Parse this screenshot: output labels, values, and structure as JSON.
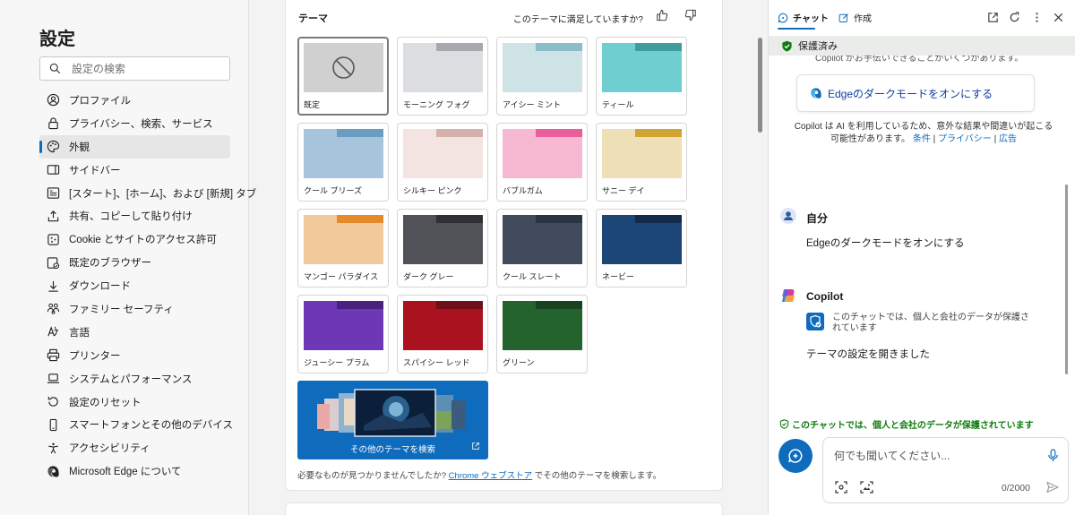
{
  "settings": {
    "title": "設定",
    "search_placeholder": "設定の検索",
    "nav": [
      {
        "label": "プロファイル",
        "icon": "profile-icon"
      },
      {
        "label": "プライバシー、検索、サービス",
        "icon": "lock-icon"
      },
      {
        "label": "外観",
        "icon": "palette-icon",
        "active": true
      },
      {
        "label": "サイドバー",
        "icon": "sidebar-icon"
      },
      {
        "label": "[スタート]、[ホーム]、および [新規] タブ",
        "icon": "home-tab-icon"
      },
      {
        "label": "共有、コピーして貼り付け",
        "icon": "share-icon"
      },
      {
        "label": "Cookie とサイトのアクセス許可",
        "icon": "cookie-icon"
      },
      {
        "label": "既定のブラウザー",
        "icon": "browser-icon"
      },
      {
        "label": "ダウンロード",
        "icon": "download-icon"
      },
      {
        "label": "ファミリー セーフティ",
        "icon": "family-icon"
      },
      {
        "label": "言語",
        "icon": "language-icon"
      },
      {
        "label": "プリンター",
        "icon": "printer-icon"
      },
      {
        "label": "システムとパフォーマンス",
        "icon": "laptop-icon"
      },
      {
        "label": "設定のリセット",
        "icon": "reset-icon"
      },
      {
        "label": "スマートフォンとその他のデバイス",
        "icon": "phone-icon"
      },
      {
        "label": "アクセシビリティ",
        "icon": "accessibility-icon"
      },
      {
        "label": "Microsoft Edge について",
        "icon": "edge-icon"
      }
    ]
  },
  "themes": {
    "title": "テーマ",
    "feedback_question": "このテーマに満足していますか?",
    "items": [
      {
        "label": "既定",
        "selected": true,
        "default": true,
        "tab": "#d0d0d0",
        "body": "#d0d0d0"
      },
      {
        "label": "モーニング フォグ",
        "tab": "#a5a9ae",
        "body": "#dcdde1"
      },
      {
        "label": "アイシー ミント",
        "tab": "#8bbdc6",
        "body": "#cde3e6"
      },
      {
        "label": "ティール",
        "tab": "#3f9d9d",
        "body": "#6fcfd0"
      },
      {
        "label": "クール ブリーズ",
        "tab": "#6b9cc2",
        "body": "#a6c4db"
      },
      {
        "label": "シルキー ピンク",
        "tab": "#d6b1ab",
        "body": "#f3e3e1"
      },
      {
        "label": "バブルガム",
        "tab": "#e95f9b",
        "body": "#f7b8d2"
      },
      {
        "label": "サニー デイ",
        "tab": "#d2a431",
        "body": "#eedfb7"
      },
      {
        "label": "マンゴー パラダイス",
        "tab": "#e48a2a",
        "body": "#f2c99b"
      },
      {
        "label": "ダーク グレー",
        "tab": "#2f3033",
        "body": "#515257"
      },
      {
        "label": "クール スレート",
        "tab": "#2b3444",
        "body": "#414b5c"
      },
      {
        "label": "ネービー",
        "tab": "#132a4a",
        "body": "#1c4676"
      },
      {
        "label": "ジューシー プラム",
        "tab": "#4b2180",
        "body": "#6e37b5"
      },
      {
        "label": "スパイシー レッド",
        "tab": "#6e1017",
        "body": "#a9121e"
      },
      {
        "label": "グリーン",
        "tab": "#19431f",
        "body": "#24632d"
      }
    ],
    "more_themes_label": "その他のテーマを検索",
    "store_note_prefix": "必要なものが見つかりませんでしたか?",
    "store_link": "Chrome ウェブストア",
    "store_note_suffix": "でその他のテーマを検索します。"
  },
  "copilot": {
    "tab_chat": "チャット",
    "tab_compose": "作成",
    "protected_label": "保護済み",
    "cut_text": "Copilot がお手伝いできることがいくつかあります。",
    "suggestion": "Edgeのダークモードをオンにする",
    "disclaimer": "Copilot は AI を利用しているため、意外な結果や間違いが起こる可能性があります。",
    "link_terms": "条件",
    "link_privacy": "プライバシー",
    "link_ads": "広告",
    "user_name": "自分",
    "user_message": "Edgeのダークモードをオンにする",
    "bot_name": "Copilot",
    "bot_protect_note": "このチャットでは、個人と会社のデータが保護されています",
    "bot_message": "テーマの設定を開きました",
    "green_note": "このチャットでは、個人と会社のデータが保護されています",
    "input_placeholder": "何でも聞いてください...",
    "counter": "0/2000"
  },
  "colors": {
    "accent": "#0f6cbd",
    "protected_green": "#107c10"
  }
}
